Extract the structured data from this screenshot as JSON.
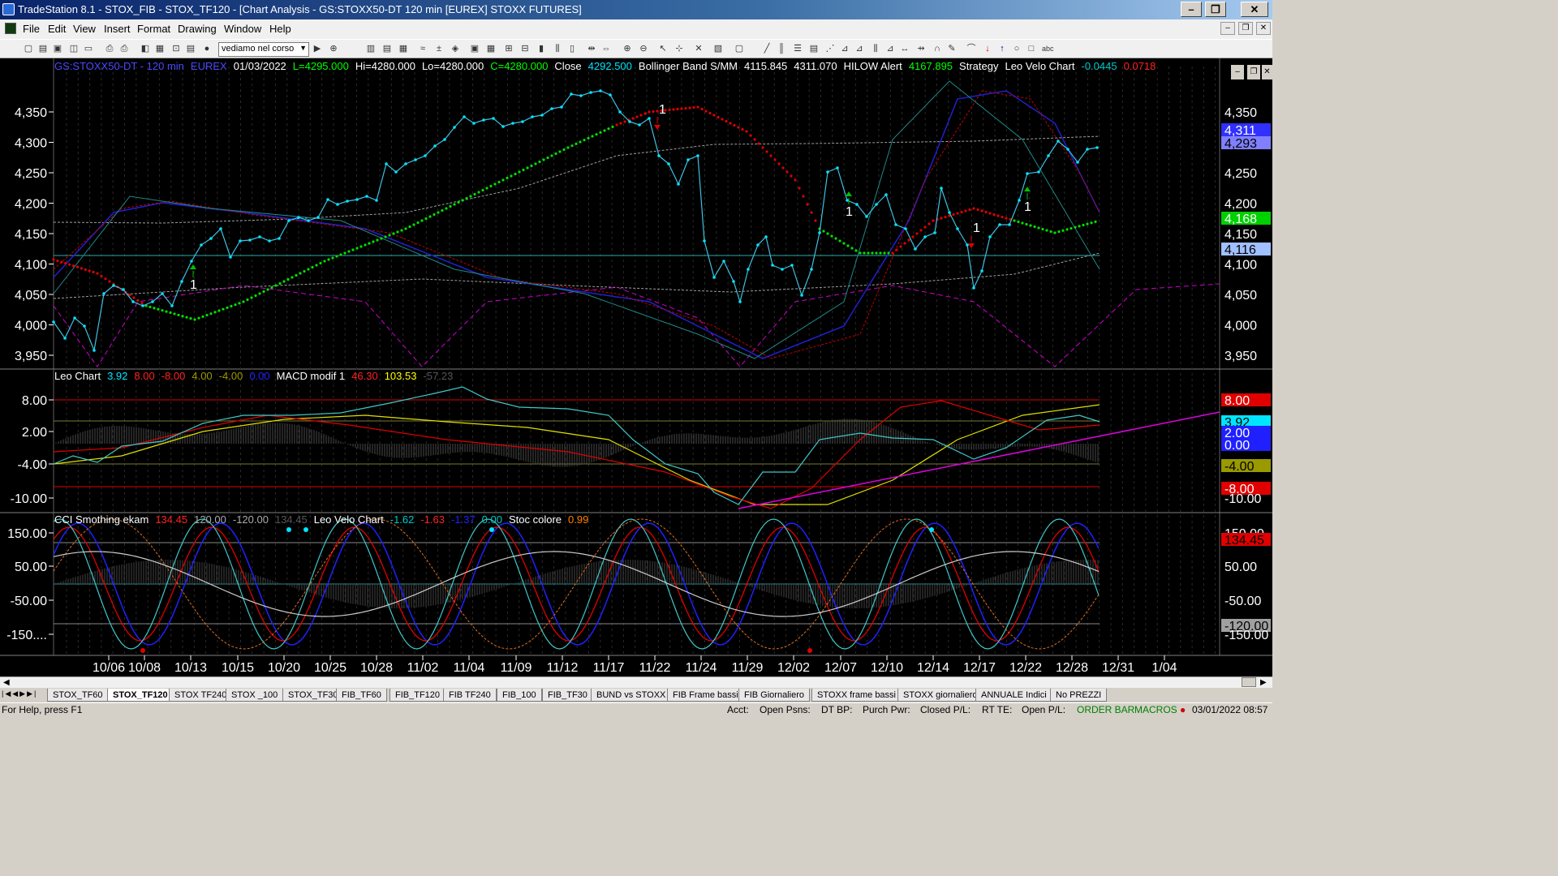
{
  "window": {
    "title": "TradeStation 8.1 - STOX_FIB - STOX_TF120 - [Chart Analysis - GS:STOXX50-DT  120 min  [EUREX] STOXX FUTURES]",
    "min": "–",
    "max": "❐",
    "close": "✕"
  },
  "menu": [
    "File",
    "Edit",
    "View",
    "Insert",
    "Format",
    "Drawing",
    "Window",
    "Help"
  ],
  "toolbar": {
    "combo_value": "vediamo nel corso"
  },
  "chart": {
    "header": [
      {
        "text": "GS:STOXX50-DT - 120 min",
        "color": "#4a4aff"
      },
      {
        "text": "EUREX",
        "color": "#4a4aff"
      },
      {
        "text": "01/03/2022",
        "color": "#ffffff"
      },
      {
        "text": "L=4295.000",
        "color": "#00ff00"
      },
      {
        "text": "Hi=4280.000",
        "color": "#ffffff"
      },
      {
        "text": "Lo=4280.000",
        "color": "#ffffff"
      },
      {
        "text": "C=4280.000",
        "color": "#00ff00"
      },
      {
        "text": "Close",
        "color": "#ffffff"
      },
      {
        "text": "4292.500",
        "color": "#00e5ff"
      },
      {
        "text": "Bollinger Band S/MM",
        "color": "#ffffff"
      },
      {
        "text": "4115.845",
        "color": "#ffffff"
      },
      {
        "text": "4311.070",
        "color": "#ffffff"
      },
      {
        "text": "HILOW Alert",
        "color": "#ffffff"
      },
      {
        "text": "4167.895",
        "color": "#00ff00"
      },
      {
        "text": "Strategy",
        "color": "#ffffff"
      },
      {
        "text": "Leo Velo Chart",
        "color": "#ffffff"
      },
      {
        "text": "-0.0445",
        "color": "#00c8c8"
      },
      {
        "text": "0.0718",
        "color": "#ff2020"
      }
    ],
    "sub1_header": [
      {
        "text": "Leo Chart",
        "color": "#ffffff"
      },
      {
        "text": "3.92",
        "color": "#00e5ff"
      },
      {
        "text": "8.00",
        "color": "#ff2020"
      },
      {
        "text": "-8.00",
        "color": "#ff2020"
      },
      {
        "text": "4.00",
        "color": "#999900"
      },
      {
        "text": "-4.00",
        "color": "#999900"
      },
      {
        "text": "0.00",
        "color": "#2020ff"
      },
      {
        "text": "MACD modif 1",
        "color": "#ffffff"
      },
      {
        "text": "46.30",
        "color": "#ff2020"
      },
      {
        "text": "103.53",
        "color": "#ffff00"
      },
      {
        "text": "-57.23",
        "color": "#555555"
      }
    ],
    "sub2_header": [
      {
        "text": "CCI Smothing ekam",
        "color": "#ffffff"
      },
      {
        "text": "134.45",
        "color": "#ff2020"
      },
      {
        "text": "120.00",
        "color": "#aaaaaa"
      },
      {
        "text": "-120.00",
        "color": "#aaaaaa"
      },
      {
        "text": "134.45",
        "color": "#555555"
      },
      {
        "text": "Leo Velo Chart",
        "color": "#ffffff"
      },
      {
        "text": "-1.62",
        "color": "#00c8c8"
      },
      {
        "text": "-1.63",
        "color": "#ff2020"
      },
      {
        "text": "-1.37",
        "color": "#2020ff"
      },
      {
        "text": "0.00",
        "color": "#00c8c8"
      },
      {
        "text": "Stoc colore",
        "color": "#ffffff"
      },
      {
        "text": "0.99",
        "color": "#ff8000"
      }
    ],
    "price_axis": [
      "4,350",
      "4,300",
      "4,250",
      "4,200",
      "4,150",
      "4,100",
      "4,050",
      "4,000",
      "3,950"
    ],
    "price_axis_right": [
      "4,350",
      "4,300",
      "4,250",
      "4,200",
      "4,150",
      "4,100",
      "4,050",
      "4,000",
      "3,950"
    ],
    "right_markers": [
      {
        "text": "4,311",
        "bg": "#3030ff",
        "fg": "#ffffff"
      },
      {
        "text": "4,293",
        "bg": "#8080ff",
        "fg": "#000000"
      },
      {
        "text": "4,168",
        "bg": "#00d000",
        "fg": "#ffffff"
      },
      {
        "text": "4,116",
        "bg": "#a0c0ff",
        "fg": "#000000"
      }
    ],
    "sub1_axis": [
      "8.00",
      "2.00",
      "-4.00",
      "-10.00"
    ],
    "sub1_axis_right": [
      "8.00",
      "3.92",
      "2.00",
      "0.00",
      "-4.00",
      "-8.00",
      "-10.00"
    ],
    "sub2_axis": [
      "150.00",
      "50.00",
      "-50.00",
      "-150...."
    ],
    "sub2_axis_right": [
      "150.00",
      "134.45",
      "50.00",
      "-50.00",
      "-120.00",
      "-150.00"
    ],
    "dates": [
      "10/06",
      "10/08",
      "10/13",
      "10/15",
      "10/20",
      "10/25",
      "10/28",
      "11/02",
      "11/04",
      "11/09",
      "11/12",
      "11/17",
      "11/22",
      "11/24",
      "11/29",
      "12/02",
      "12/07",
      "12/10",
      "12/14",
      "12/17",
      "12/22",
      "12/28",
      "12/31",
      "1/04"
    ],
    "signals": [
      "1",
      "1",
      "1",
      "1",
      "1"
    ]
  },
  "tabs": [
    "STOX_TF60",
    "STOX_TF120",
    "STOX TF240",
    "STOX _100",
    "STOX_TF30",
    "FIB_TF60",
    "FIB_TF120",
    "FIB TF240",
    "FIB_100",
    "FIB_TF30",
    "BUND vs STOXX",
    "FIB Frame bassi",
    "FIB Giornaliero",
    "STOXX frame bassi",
    "STOXX giornaliero",
    "ANNUALE Indici",
    "No PREZZI"
  ],
  "active_tab": "STOX_TF120",
  "status": {
    "help": "For Help, press F1",
    "acct": "Acct:",
    "open_psns": "Open Psns:",
    "dt_bp": "DT BP:",
    "purch_pwr": "Purch Pwr:",
    "closed_pl": "Closed P/L:",
    "rt_te": "RT TE:",
    "open_pl": "Open P/L:",
    "order_bar": "ORDER BAR",
    "macros": "MACROS",
    "datetime": "03/01/2022 08:57"
  }
}
